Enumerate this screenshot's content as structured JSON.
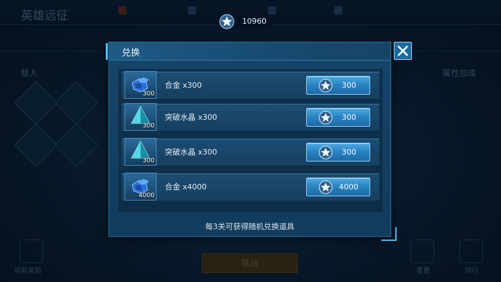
{
  "background": {
    "title": "英雄远征",
    "heroes_header": "敌人",
    "attr_header": "属性加成",
    "bottom_button": "挑战",
    "left_corner_label": "领取奖励",
    "right_corner_labels": [
      "重置",
      "排行"
    ]
  },
  "currency": {
    "icon": "star-badge-icon",
    "amount": "10960"
  },
  "dialog": {
    "title": "兑换",
    "close_icon": "close-icon",
    "items": [
      {
        "name": "合金 x300",
        "icon": "alloy-icon",
        "qty": "300",
        "price": "300"
      },
      {
        "name": "突破水晶 x300",
        "icon": "crystal-icon",
        "qty": "300",
        "price": "300"
      },
      {
        "name": "突破水晶 x300",
        "icon": "crystal-icon",
        "qty": "300",
        "price": "300"
      },
      {
        "name": "合金 x4000",
        "icon": "alloy-icon",
        "qty": "4000",
        "price": "4000"
      }
    ],
    "footer": "每3关可获得随机兑换道具"
  },
  "colors": {
    "accent": "#4fc3f2",
    "button_top": "#4aa9e0",
    "button_bottom": "#1e6aa6",
    "panel": "#16456a"
  }
}
